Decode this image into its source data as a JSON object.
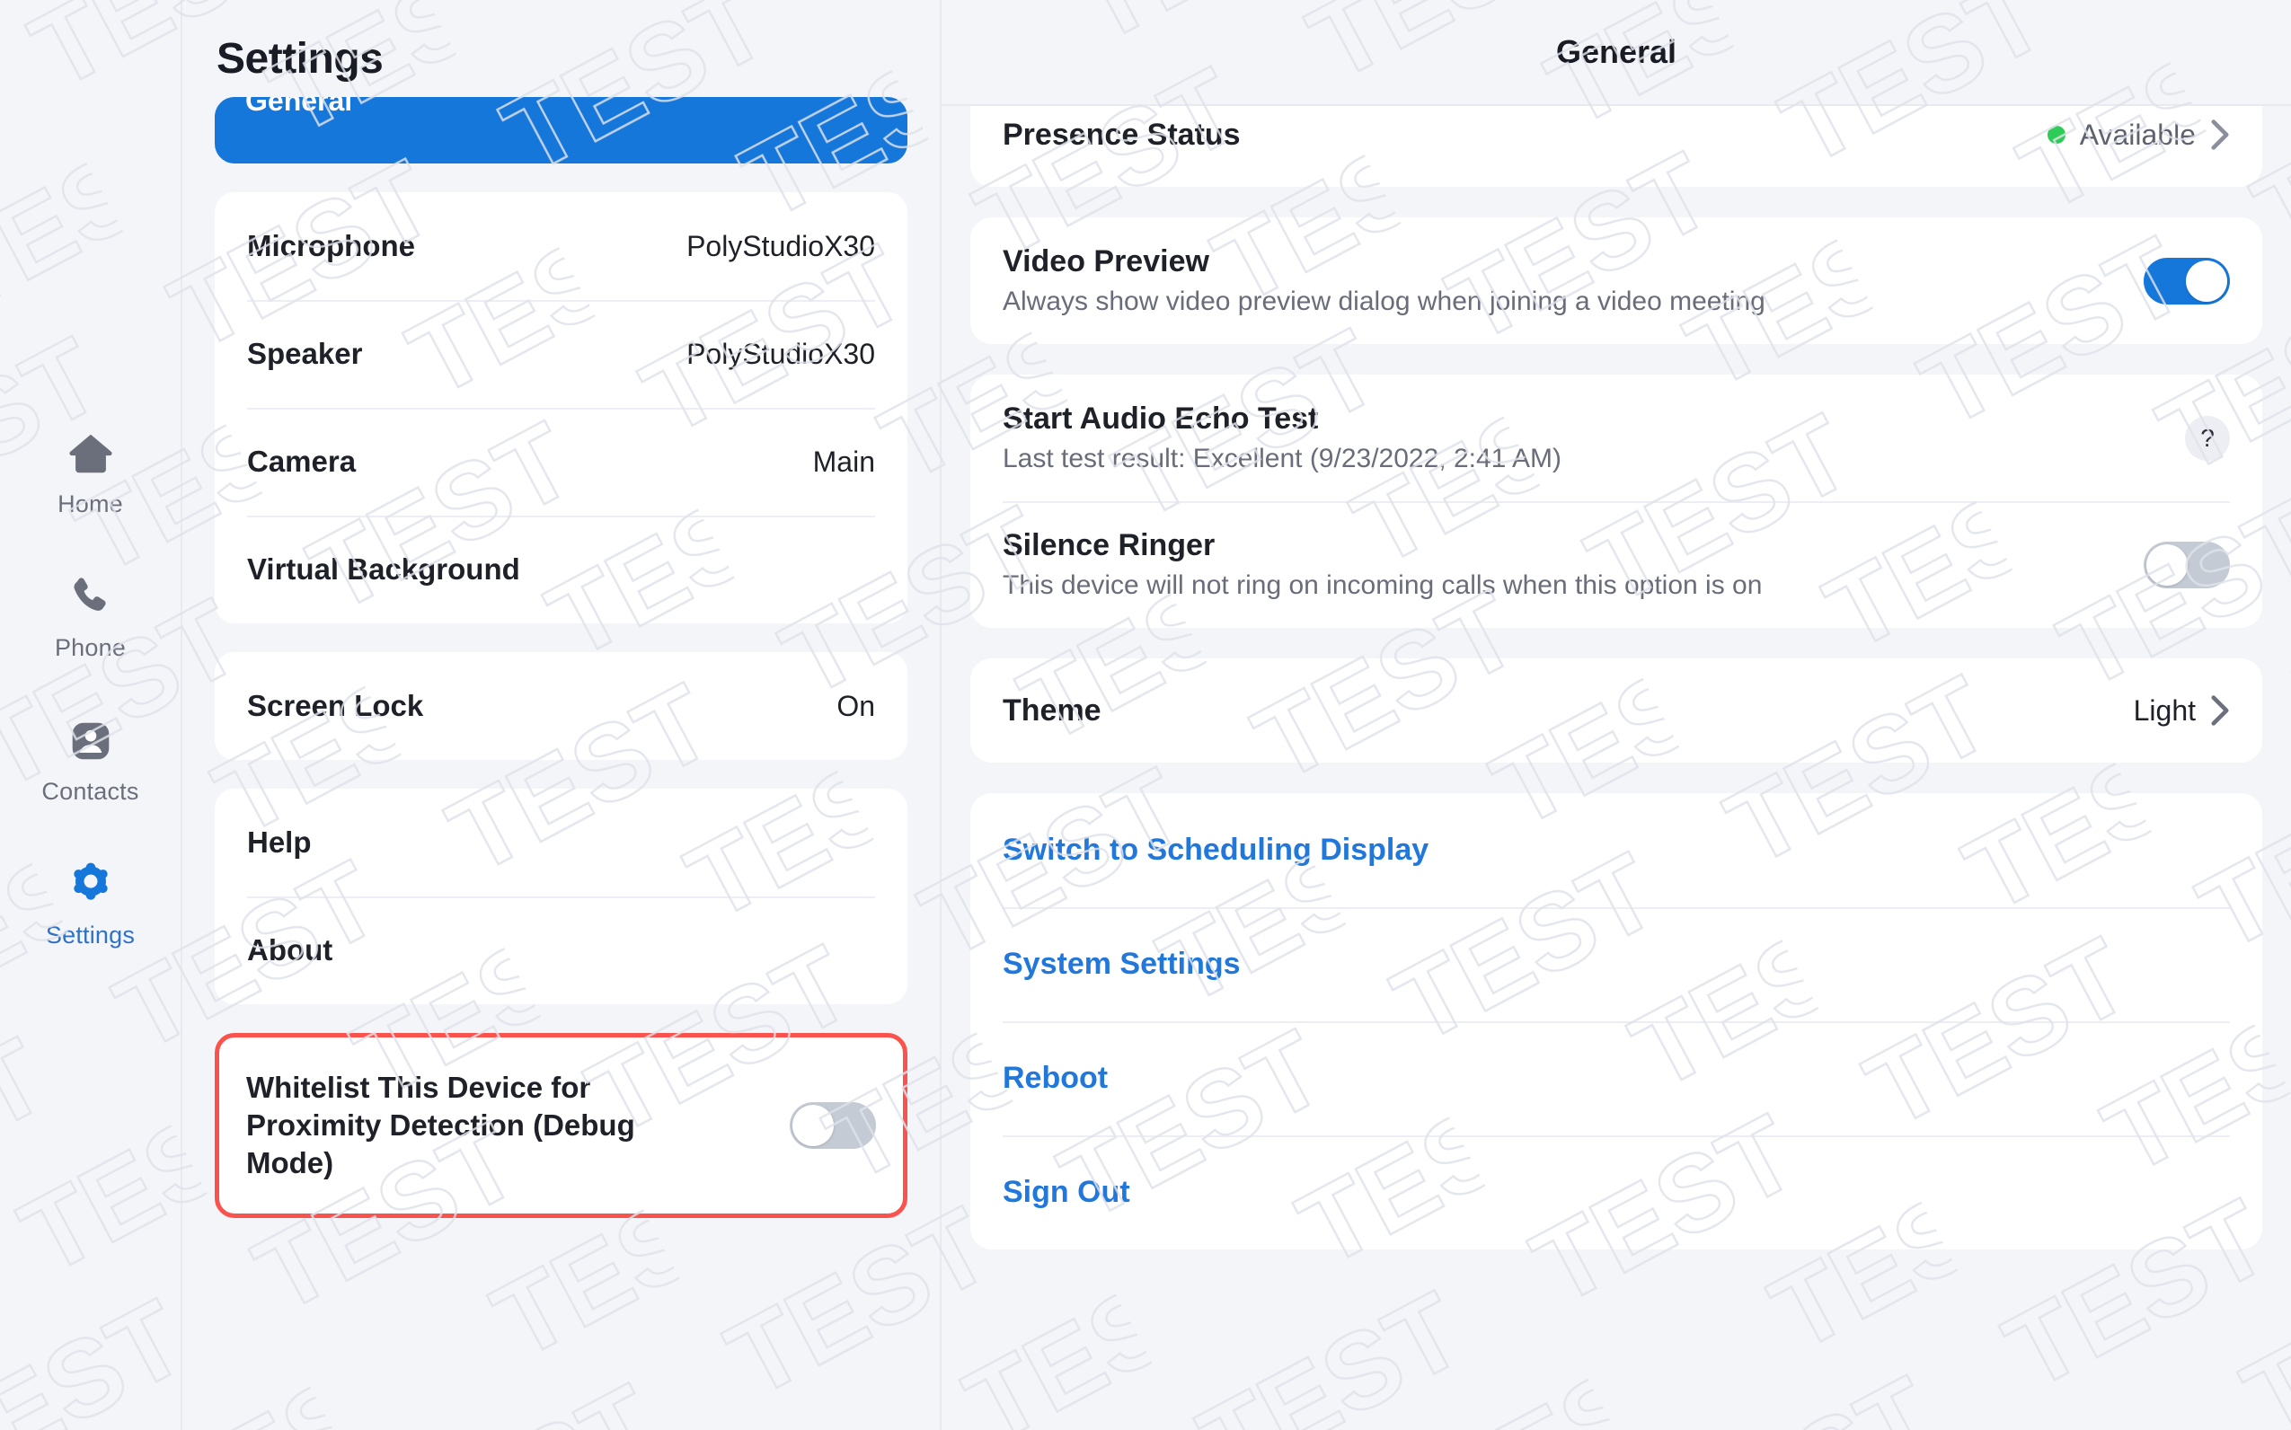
{
  "colors": {
    "accent_blue": "#1677db",
    "link_blue": "#2178da",
    "highlight_red": "#fa534d",
    "status_green": "#2ecb57",
    "toggle_off_grey": "#c5cbd4",
    "page_bg": "#f4f5f9",
    "card_bg": "#ffffff"
  },
  "watermark": {
    "text": "TEST"
  },
  "rail": {
    "items": [
      {
        "label": "Home",
        "icon": "home-icon",
        "active": false
      },
      {
        "label": "Phone",
        "icon": "phone-icon",
        "active": false
      },
      {
        "label": "Contacts",
        "icon": "contacts-icon",
        "active": false
      },
      {
        "label": "Settings",
        "icon": "gear-icon",
        "active": true
      }
    ]
  },
  "settings": {
    "title": "Settings",
    "selected_nav_item": "General",
    "groups": [
      {
        "rows": [
          {
            "label": "Microphone",
            "value": "PolyStudioX30"
          },
          {
            "label": "Speaker",
            "value": "PolyStudioX30"
          },
          {
            "label": "Camera",
            "value": "Main"
          },
          {
            "label": "Virtual Background",
            "value": ""
          }
        ]
      },
      {
        "rows": [
          {
            "label": "Screen Lock",
            "value": "On"
          }
        ]
      },
      {
        "rows": [
          {
            "label": "Help",
            "value": ""
          },
          {
            "label": "About",
            "value": ""
          }
        ]
      }
    ],
    "debug_row": {
      "label": "Whitelist This Device for Proximity Detection (Debug Mode)",
      "toggle_state": "off"
    }
  },
  "detail": {
    "title": "General",
    "presence": {
      "label": "Presence Status",
      "value": "Available",
      "indicator": "status-dot-green"
    },
    "video_preview": {
      "title": "Video Preview",
      "subtitle": "Always show video preview dialog when joining a video meeting",
      "toggle_state": "on"
    },
    "echo_test": {
      "title": "Start Audio Echo Test",
      "subtitle": "Last test result: Excellent (9/23/2022, 2:41 AM)",
      "help_glyph": "?"
    },
    "silence_ringer": {
      "title": "Silence Ringer",
      "subtitle": "This device will not ring on incoming calls when this option is on",
      "toggle_state": "off"
    },
    "theme": {
      "label": "Theme",
      "value": "Light"
    },
    "actions": [
      {
        "label": "Switch to Scheduling Display"
      },
      {
        "label": "System Settings"
      },
      {
        "label": "Reboot"
      },
      {
        "label": "Sign Out"
      }
    ]
  }
}
